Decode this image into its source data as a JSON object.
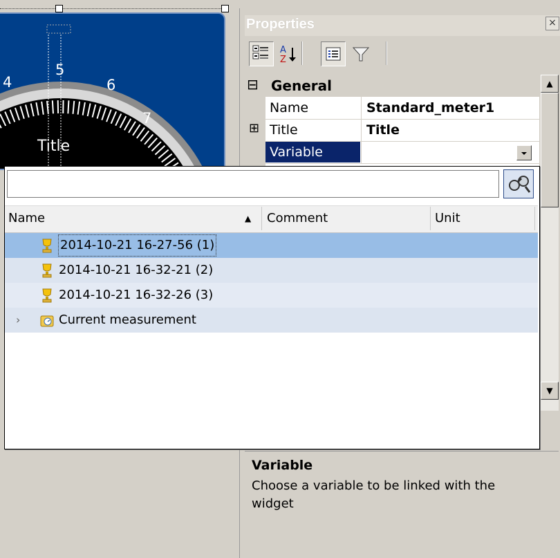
{
  "meter": {
    "dial_numbers": [
      "4",
      "5",
      "6",
      "7"
    ],
    "title": "Title"
  },
  "properties": {
    "title": "Properties",
    "close_label": "×",
    "toolbar": [
      {
        "name": "categorized-view",
        "pressed": true
      },
      {
        "name": "alphabetical-sort",
        "pressed": false
      },
      {
        "name": "property-pages",
        "pressed": true
      },
      {
        "name": "filter",
        "pressed": false
      }
    ],
    "category": {
      "expander": "⊟",
      "label": "General"
    },
    "rows": [
      {
        "expander": "",
        "name": "Name",
        "value": "Standard_meter1",
        "selected": false
      },
      {
        "expander": "⊞",
        "name": "Title",
        "value": "Title",
        "selected": false
      },
      {
        "expander": "",
        "name": "Variable",
        "value": "",
        "selected": true
      }
    ],
    "help": {
      "title": "Variable",
      "text": "Choose a variable to be linked with the widget"
    }
  },
  "popup": {
    "search_value": "",
    "columns": [
      {
        "label": "Name",
        "sort_indicator": "▲"
      },
      {
        "label": "Comment"
      },
      {
        "label": "Unit"
      }
    ],
    "items": [
      {
        "label": "2014-10-21 16-27-56 (1)",
        "selected": true,
        "expandable": false
      },
      {
        "label": "2014-10-21 16-32-21 (2)",
        "selected": false,
        "expandable": false
      },
      {
        "label": "2014-10-21 16-32-26 (3)",
        "selected": false,
        "expandable": false
      },
      {
        "label": "Current measurement",
        "selected": false,
        "expandable": true
      }
    ]
  },
  "colors": {
    "selected_row": "#98bde6",
    "alt_row": "#dce4f0",
    "variable_highlight": "#0a246a",
    "meter_panel": "#003f8a"
  }
}
